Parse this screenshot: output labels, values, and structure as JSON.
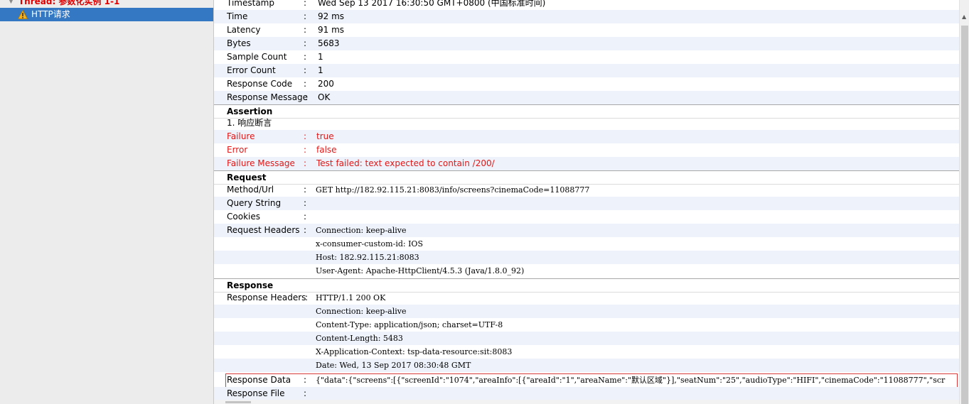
{
  "tree": {
    "thread_label": "Thread: 参数化实例 1-1",
    "request_label": "HTTP请求"
  },
  "sampler": {
    "rows": [
      {
        "key": "Timestamp",
        "value": "Wed Sep 13 2017 16:30:50 GMT+0800 (中国标准时间)"
      },
      {
        "key": "Time",
        "value": "92 ms"
      },
      {
        "key": "Latency",
        "value": "91 ms"
      },
      {
        "key": "Bytes",
        "value": "5683"
      },
      {
        "key": "Sample Count",
        "value": "1"
      },
      {
        "key": "Error Count",
        "value": "1"
      },
      {
        "key": "Response Code",
        "value": "200"
      },
      {
        "key": "Response Message",
        "value": "OK"
      }
    ]
  },
  "assertion": {
    "heading": "Assertion",
    "item": "1. 响应断言",
    "rows": [
      {
        "key": "Failure",
        "value": "true"
      },
      {
        "key": "Error",
        "value": "false"
      },
      {
        "key": "Failure Message",
        "value": "Test failed: text expected to contain /200/"
      }
    ]
  },
  "request": {
    "heading": "Request",
    "method_url_key": "Method/Url",
    "method_url": "GET http://182.92.115.21:8083/info/screens?cinemaCode=11088777",
    "query_string_key": "Query String",
    "cookies_key": "Cookies",
    "headers_key": "Request Headers",
    "headers": [
      "Connection: keep-alive",
      "x-consumer-custom-id: IOS",
      "Host: 182.92.115.21:8083",
      "User-Agent: Apache-HttpClient/4.5.3 (Java/1.8.0_92)"
    ]
  },
  "response": {
    "heading": "Response",
    "headers_key": "Response Headers",
    "headers": [
      "HTTP/1.1 200 OK",
      "Connection: keep-alive",
      "Content-Type: application/json; charset=UTF-8",
      "Content-Length: 5483",
      "X-Application-Context: tsp-data-resource:sit:8083",
      "Date: Wed, 13 Sep 2017 08:30:48 GMT"
    ],
    "data_key": "Response Data",
    "data": "{\"data\":{\"screens\":[{\"screenId\":\"1074\",\"areaInfo\":[{\"areaId\":\"1\",\"areaName\":\"默认区域\"}],\"seatNum\":\"25\",\"audioType\":\"HIFI\",\"cinemaCode\":\"11088777\",\"scr",
    "file_key": "Response File"
  },
  "separator": ":",
  "colors": {
    "selection": "#3478c4",
    "failure_red": "#e01818",
    "alt_row": "#eef3fb",
    "highlight_box": "#d63a3a"
  }
}
